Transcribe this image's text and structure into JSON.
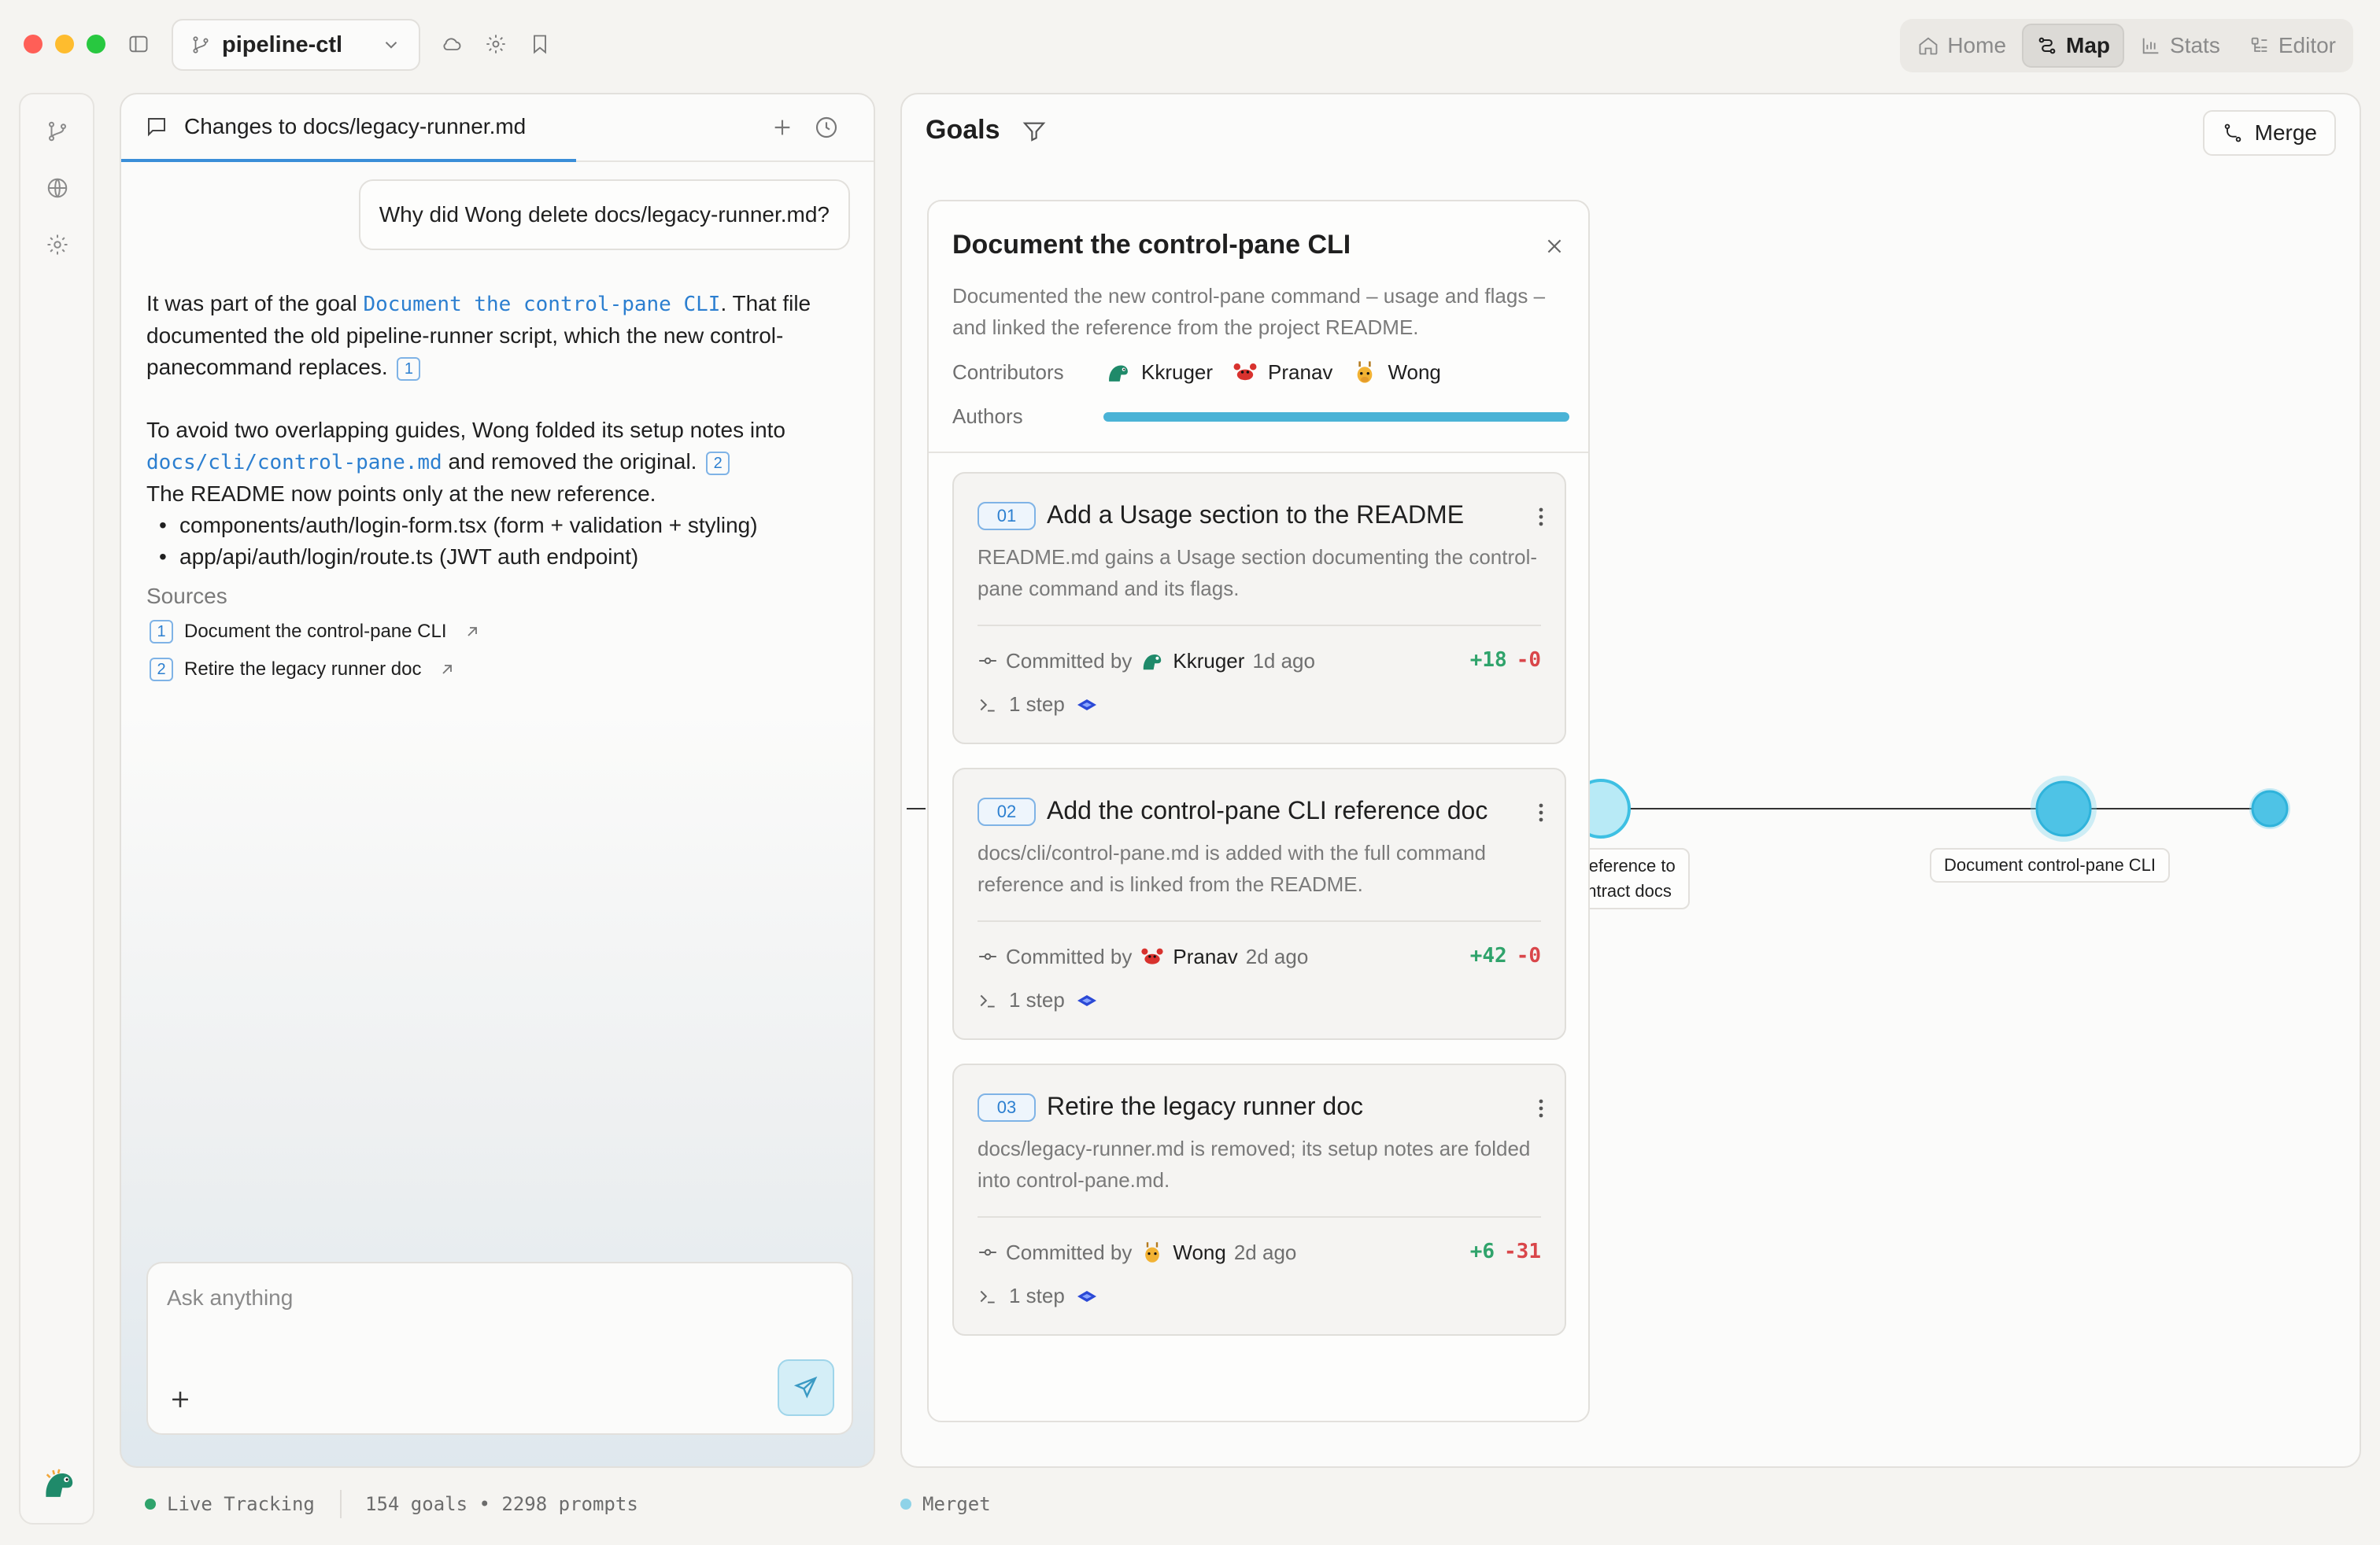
{
  "window": {
    "repo": "pipeline-ctl",
    "nav": [
      {
        "label": "Home",
        "icon": "home-icon"
      },
      {
        "label": "Map",
        "icon": "map-icon",
        "active": true
      },
      {
        "label": "Stats",
        "icon": "stats-icon"
      },
      {
        "label": "Editor",
        "icon": "editor-icon"
      }
    ]
  },
  "chat": {
    "tab_title": "Changes to docs/legacy-runner.md",
    "user_message": "Why did Wong delete docs/legacy-runner.md?",
    "answer": {
      "p1_pre": "It was part of the goal ",
      "p1_link": "Document the control-pane CLI",
      "p1_mid": ". That file documented the old pipeline-runner script, which the new control-panecommand replaces.",
      "p1_cite": "1",
      "p2_pre": "To avoid two overlapping guides, Wong folded its setup notes into ",
      "p2_link": "docs/cli/control-pane.md",
      "p2_mid": " and removed the original.",
      "p2_cite": "2",
      "p2_post": "The README now points only at the new reference.",
      "bullets": [
        "components/auth/login-form.tsx (form + validation + styling)",
        "app/api/auth/login/route.ts (JWT auth endpoint)"
      ]
    },
    "sources_title": "Sources",
    "sources": [
      {
        "num": "1",
        "label": "Document the control-pane CLI"
      },
      {
        "num": "2",
        "label": "Retire the legacy runner doc"
      }
    ],
    "composer_placeholder": "Ask anything"
  },
  "status": {
    "live": "Live Tracking",
    "counts": "154 goals • 2298 prompts",
    "merget": "Merget",
    "live_color": "#2fa36b",
    "merget_color": "#8fd3e8"
  },
  "goals": {
    "title": "Goals",
    "merge_label": "Merge",
    "graph_labels": [
      {
        "line1": "-reference to",
        "line2": "ontract docs"
      },
      {
        "line1": "Document control-pane CLI"
      }
    ],
    "card": {
      "title": "Document the control-pane CLI",
      "description": "Documented the new control-pane command – usage and flags – and linked the reference from the project README.",
      "contributors_label": "Contributors",
      "authors_label": "Authors",
      "contributors": [
        {
          "name": "Kkruger",
          "avatar": "dino-icon"
        },
        {
          "name": "Pranav",
          "avatar": "crab-icon"
        },
        {
          "name": "Wong",
          "avatar": "giraffe-icon"
        }
      ],
      "steps": [
        {
          "num": "01",
          "title": "Add a Usage section to the README",
          "description": "README.md gains a Usage section documenting the control-pane command and its flags.",
          "committed_by": "Committed by",
          "author": "Kkruger",
          "avatar": "dino-icon",
          "when": "1d ago",
          "additions": "+18",
          "deletions": "-0",
          "steps": "1 step"
        },
        {
          "num": "02",
          "title": "Add the control-pane CLI reference doc",
          "description": "docs/cli/control-pane.md is added with the full command reference and is linked from the README.",
          "committed_by": "Committed by",
          "author": "Pranav",
          "avatar": "crab-icon",
          "when": "2d ago",
          "additions": "+42",
          "deletions": "-0",
          "steps": "1 step"
        },
        {
          "num": "03",
          "title": "Retire the legacy runner doc",
          "description": "docs/legacy-runner.md is removed; its setup notes are folded into control-pane.md.",
          "committed_by": "Committed by",
          "author": "Wong",
          "avatar": "giraffe-icon",
          "when": "2d ago",
          "additions": "+6",
          "deletions": "-31",
          "steps": "1 step"
        }
      ]
    }
  },
  "colors": {
    "accent": "#3a8ed8",
    "node": "#4ec3e6",
    "addition": "#2fa36b",
    "deletion": "#d9464a"
  }
}
